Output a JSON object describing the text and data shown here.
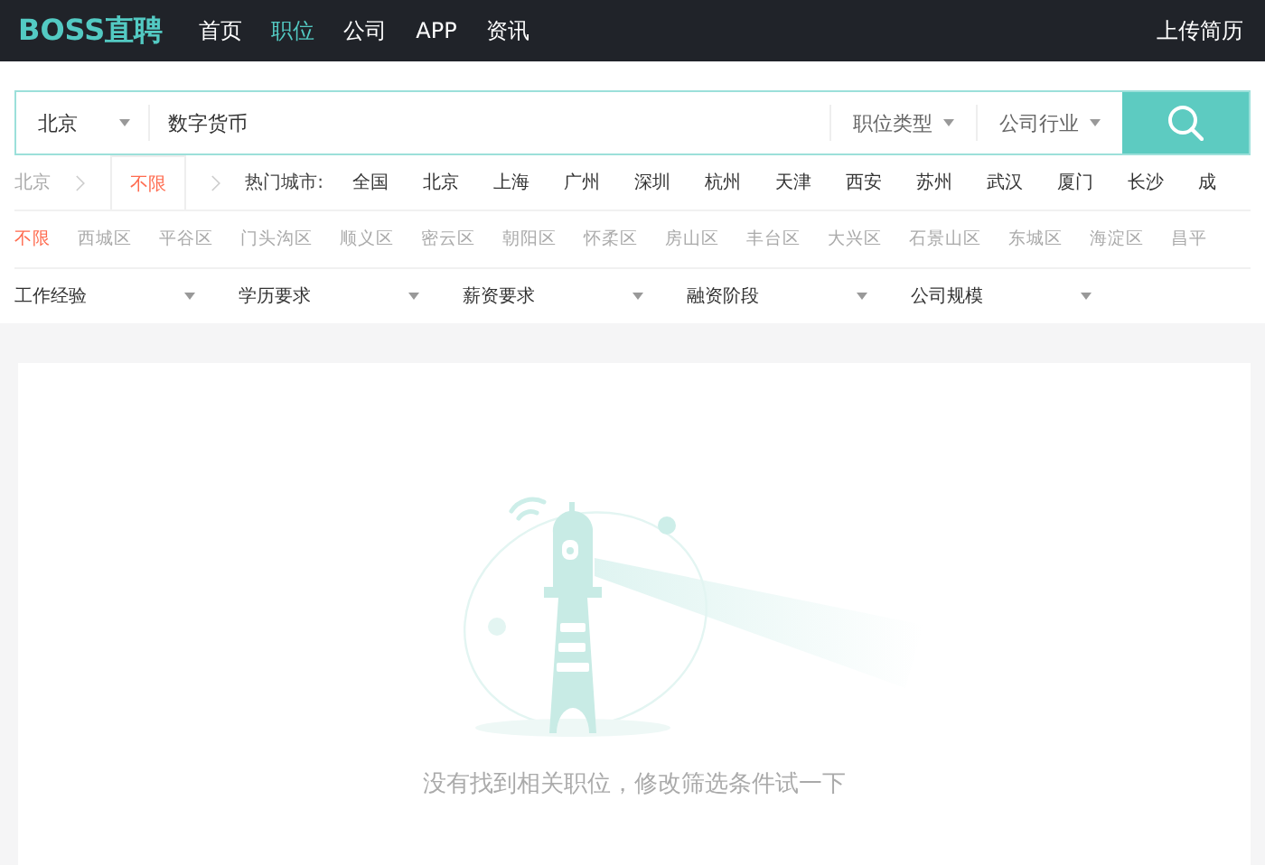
{
  "header": {
    "logo": "BOSS直聘",
    "nav": [
      {
        "label": "首页",
        "selected": false
      },
      {
        "label": "职位",
        "selected": true
      },
      {
        "label": "公司",
        "selected": false
      },
      {
        "label": "APP",
        "selected": false
      },
      {
        "label": "资讯",
        "selected": false
      }
    ],
    "upload": "上传简历"
  },
  "search": {
    "city": "北京",
    "query": "数字货币",
    "dropdowns": [
      "职位类型",
      "公司行业"
    ]
  },
  "city_row": {
    "crumb": "北京",
    "area_tab": {
      "label": "不限",
      "selected": true
    },
    "hot_label": "热门城市:",
    "cities": [
      "全国",
      "北京",
      "上海",
      "广州",
      "深圳",
      "杭州",
      "天津",
      "西安",
      "苏州",
      "武汉",
      "厦门",
      "长沙",
      "成"
    ]
  },
  "districts": [
    {
      "label": "不限",
      "selected": true
    },
    {
      "label": "西城区",
      "selected": false
    },
    {
      "label": "平谷区",
      "selected": false
    },
    {
      "label": "门头沟区",
      "selected": false
    },
    {
      "label": "顺义区",
      "selected": false
    },
    {
      "label": "密云区",
      "selected": false
    },
    {
      "label": "朝阳区",
      "selected": false
    },
    {
      "label": "怀柔区",
      "selected": false
    },
    {
      "label": "房山区",
      "selected": false
    },
    {
      "label": "丰台区",
      "selected": false
    },
    {
      "label": "大兴区",
      "selected": false
    },
    {
      "label": "石景山区",
      "selected": false
    },
    {
      "label": "东城区",
      "selected": false
    },
    {
      "label": "海淀区",
      "selected": false
    },
    {
      "label": "昌平",
      "selected": false
    }
  ],
  "filters": [
    "工作经验",
    "学历要求",
    "薪资要求",
    "融资阶段",
    "公司规模"
  ],
  "empty_message": "没有找到相关职位，修改筛选条件试一下"
}
